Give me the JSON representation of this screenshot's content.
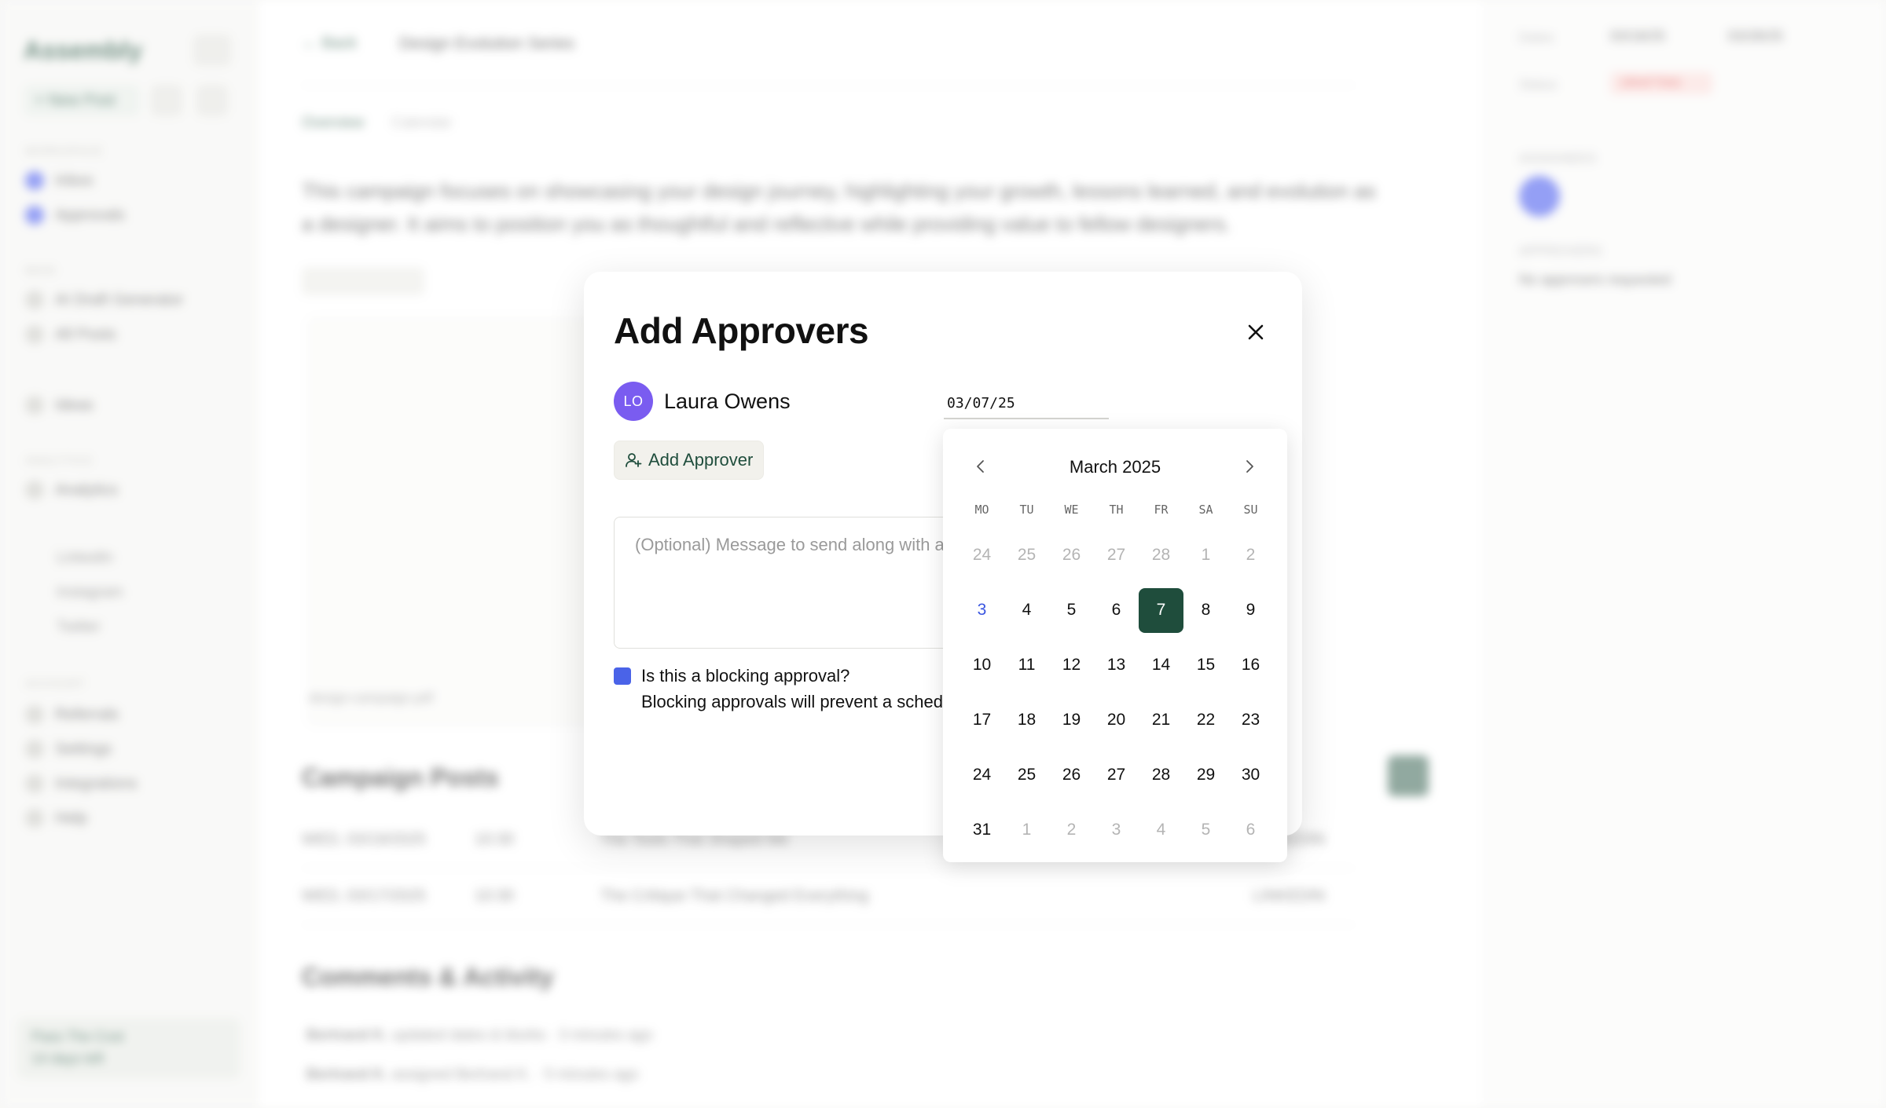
{
  "background": {
    "logo": "Assembly",
    "new_post": "+ New Post",
    "sections": {
      "workspace": "WORKSPACE",
      "main": "MAIN",
      "analytics": "ANALYTICS",
      "account": "ACCOUNT"
    },
    "sidebar_items": {
      "inbox": "Inbox",
      "approvals": "Approvals",
      "ai_draft": "AI Draft Generator",
      "all_posts": "All Posts",
      "ideas": "Ideas",
      "analytics": "Analytics",
      "linkedin": "LinkedIn",
      "instagram": "Instagram",
      "twitter": "Twitter",
      "referrals": "Referrals",
      "settings": "Settings",
      "integrations": "Integrations",
      "help": "Help"
    },
    "trial": {
      "line1": "Pass The Cost",
      "line2": "14 days left"
    },
    "back": "← Back",
    "page_title": "Design Evolution Series",
    "tabs": [
      "Overview",
      "Calendar"
    ],
    "description": "This campaign focuses on showcasing your design journey, highlighting your growth, lessons learned, and evolution as a designer. It aims to position you as thoughtful and reflective while providing value to fellow designers.",
    "media_caption": "design-campaign.pdf",
    "campaign_posts_title": "Campaign Posts",
    "posts": [
      {
        "date": "WED, 03/19/2025",
        "time": "10:30",
        "title": "The Tools That Shaped Me",
        "platform": "LINKEDIN"
      },
      {
        "date": "WED, 03/17/2025",
        "time": "10:30",
        "title": "The Critique That Changed Everything",
        "platform": "LINKEDIN"
      }
    ],
    "comments_title": "Comments & Activity",
    "activity": [
      {
        "user": "Bertrand K.",
        "text": "updated dates & blurbs · 3 minutes ago"
      },
      {
        "user": "Bertrand K.",
        "text": "assigned Bertrand K. · 5 minutes ago"
      }
    ],
    "right_pane": {
      "dates_label": "Dates",
      "start": "03/18/25",
      "end": "03/28/25",
      "status_label": "Status",
      "status_value": "DRAFTING",
      "assignees_label": "ASSIGNEES",
      "approvers_label": "APPROVERS",
      "no_approvers": "No approvers requested"
    }
  },
  "modal": {
    "title": "Add Approvers",
    "approver": {
      "initials": "LO",
      "name": "Laura Owens",
      "date_value": "03/07/25"
    },
    "add_approver_label": "Add Approver",
    "message_placeholder": "(Optional) Message to send along with approval request",
    "blocking_question": "Is this a blocking approval?",
    "blocking_description": "Blocking approvals will prevent a scheduled post from being published"
  },
  "calendar": {
    "month_label": "March 2025",
    "weekdays": [
      "MO",
      "TU",
      "WE",
      "TH",
      "FR",
      "SA",
      "SU"
    ],
    "weeks": [
      [
        {
          "d": "24",
          "s": "muted"
        },
        {
          "d": "25",
          "s": "muted"
        },
        {
          "d": "26",
          "s": "muted"
        },
        {
          "d": "27",
          "s": "muted"
        },
        {
          "d": "28",
          "s": "muted"
        },
        {
          "d": "1",
          "s": "muted"
        },
        {
          "d": "2",
          "s": "muted"
        }
      ],
      [
        {
          "d": "3",
          "s": "today"
        },
        {
          "d": "4",
          "s": ""
        },
        {
          "d": "5",
          "s": ""
        },
        {
          "d": "6",
          "s": ""
        },
        {
          "d": "7",
          "s": "selected"
        },
        {
          "d": "8",
          "s": ""
        },
        {
          "d": "9",
          "s": ""
        }
      ],
      [
        {
          "d": "10",
          "s": ""
        },
        {
          "d": "11",
          "s": ""
        },
        {
          "d": "12",
          "s": ""
        },
        {
          "d": "13",
          "s": ""
        },
        {
          "d": "14",
          "s": ""
        },
        {
          "d": "15",
          "s": ""
        },
        {
          "d": "16",
          "s": ""
        }
      ],
      [
        {
          "d": "17",
          "s": ""
        },
        {
          "d": "18",
          "s": ""
        },
        {
          "d": "19",
          "s": ""
        },
        {
          "d": "20",
          "s": ""
        },
        {
          "d": "21",
          "s": ""
        },
        {
          "d": "22",
          "s": ""
        },
        {
          "d": "23",
          "s": ""
        }
      ],
      [
        {
          "d": "24",
          "s": ""
        },
        {
          "d": "25",
          "s": ""
        },
        {
          "d": "26",
          "s": ""
        },
        {
          "d": "27",
          "s": ""
        },
        {
          "d": "28",
          "s": ""
        },
        {
          "d": "29",
          "s": ""
        },
        {
          "d": "30",
          "s": ""
        }
      ],
      [
        {
          "d": "31",
          "s": ""
        },
        {
          "d": "1",
          "s": "muted"
        },
        {
          "d": "2",
          "s": "muted"
        },
        {
          "d": "3",
          "s": "muted"
        },
        {
          "d": "4",
          "s": "muted"
        },
        {
          "d": "5",
          "s": "muted"
        },
        {
          "d": "6",
          "s": "muted"
        }
      ]
    ]
  },
  "colors": {
    "brand_green": "#1f4d3c",
    "checkbox_blue": "#4a63e8",
    "avatar_purple": "#7a5cf0",
    "today_blue": "#3a55e0"
  },
  "icons": {
    "close": "close-icon",
    "add_user": "user-plus-icon",
    "prev": "chevron-left-icon",
    "next": "chevron-right-icon"
  }
}
